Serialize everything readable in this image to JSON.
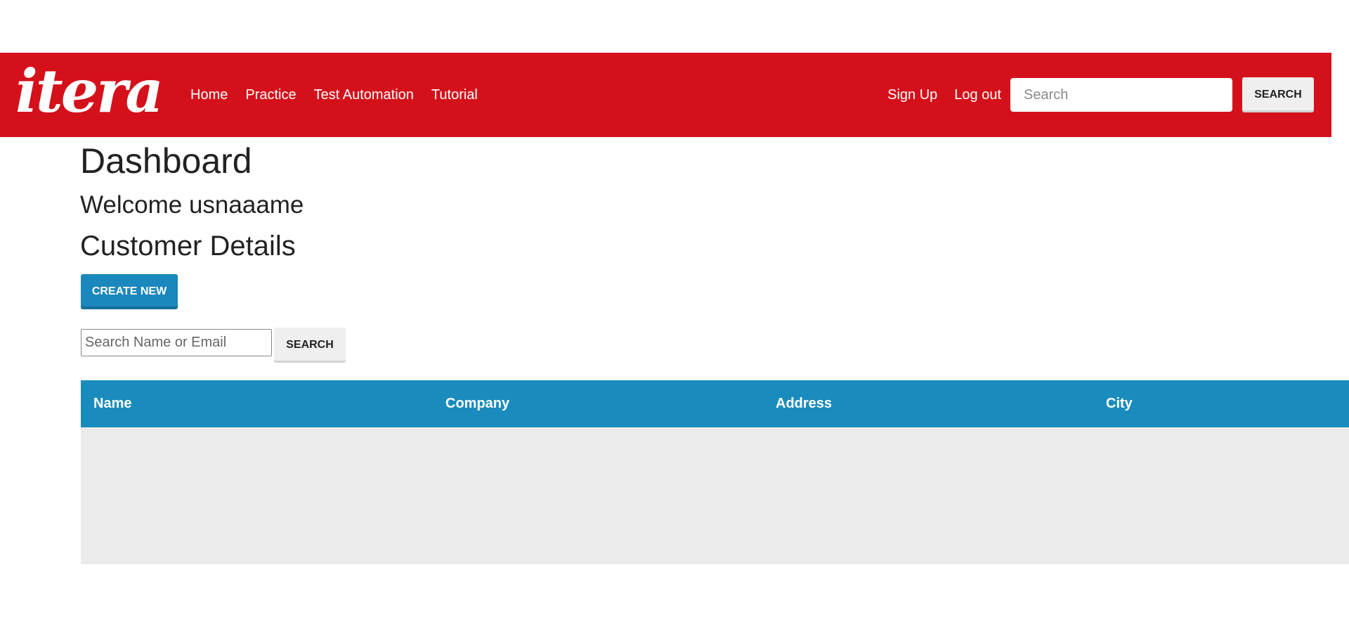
{
  "navbar": {
    "logo_text": "itera",
    "links": [
      "Home",
      "Practice",
      "Test Automation",
      "Tutorial"
    ],
    "right_links": [
      "Sign Up",
      "Log out"
    ],
    "search_placeholder": "Search",
    "search_button": "SEARCH",
    "brand_color": "#d4111b"
  },
  "main": {
    "title": "Dashboard",
    "welcome": "Welcome usnaaame",
    "section_title": "Customer Details",
    "create_button": "CREATE NEW",
    "filter_placeholder": "Search Name or Email",
    "filter_button": "SEARCH",
    "accent_color": "#1a87bd"
  },
  "table": {
    "columns": [
      "Name",
      "Company",
      "Address",
      "City"
    ],
    "rows": []
  }
}
